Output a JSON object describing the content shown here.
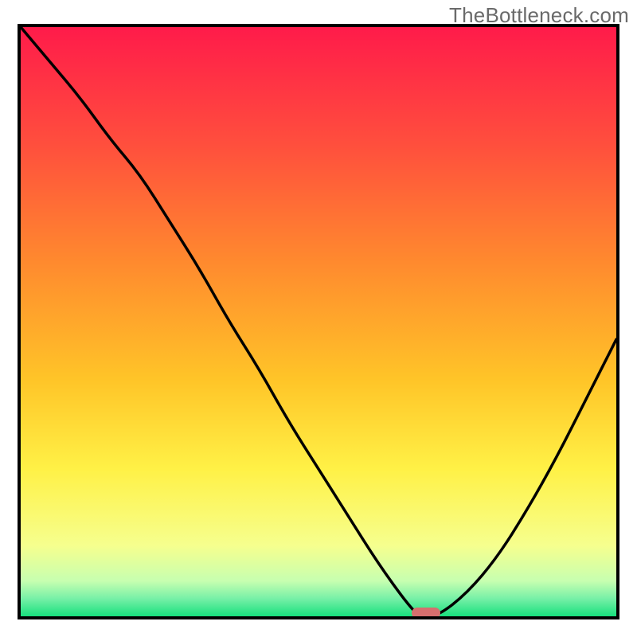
{
  "watermark": "TheBottleneck.com",
  "plot": {
    "inner_width": 748,
    "inner_height": 740
  },
  "chart_data": {
    "type": "line",
    "title": "",
    "xlabel": "",
    "ylabel": "",
    "xlim": [
      0,
      100
    ],
    "ylim": [
      0,
      100
    ],
    "grid": false,
    "x": [
      0,
      5,
      10,
      15,
      20,
      25,
      30,
      35,
      40,
      45,
      50,
      55,
      60,
      65,
      67,
      70,
      75,
      80,
      85,
      90,
      95,
      100
    ],
    "values": [
      100,
      94,
      88,
      81,
      75,
      67,
      59,
      50,
      42,
      33,
      25,
      17,
      9,
      2,
      0,
      0,
      4,
      10,
      18,
      27,
      37,
      47
    ],
    "series": [
      {
        "name": "bottleneck-curve",
        "x": [
          0,
          5,
          10,
          15,
          20,
          25,
          30,
          35,
          40,
          45,
          50,
          55,
          60,
          65,
          67,
          70,
          75,
          80,
          85,
          90,
          95,
          100
        ],
        "y": [
          100,
          94,
          88,
          81,
          75,
          67,
          59,
          50,
          42,
          33,
          25,
          17,
          9,
          2,
          0,
          0,
          4,
          10,
          18,
          27,
          37,
          47
        ]
      }
    ],
    "marker": {
      "x": 68,
      "y": 0
    },
    "gradient_stops": [
      {
        "offset": 0.0,
        "color": "#ff1b4a"
      },
      {
        "offset": 0.2,
        "color": "#ff4f3d"
      },
      {
        "offset": 0.4,
        "color": "#ff8a2e"
      },
      {
        "offset": 0.6,
        "color": "#ffc528"
      },
      {
        "offset": 0.75,
        "color": "#fff146"
      },
      {
        "offset": 0.88,
        "color": "#f6ff8e"
      },
      {
        "offset": 0.94,
        "color": "#c7ffb0"
      },
      {
        "offset": 0.97,
        "color": "#77f0a7"
      },
      {
        "offset": 1.0,
        "color": "#18e07d"
      }
    ]
  }
}
